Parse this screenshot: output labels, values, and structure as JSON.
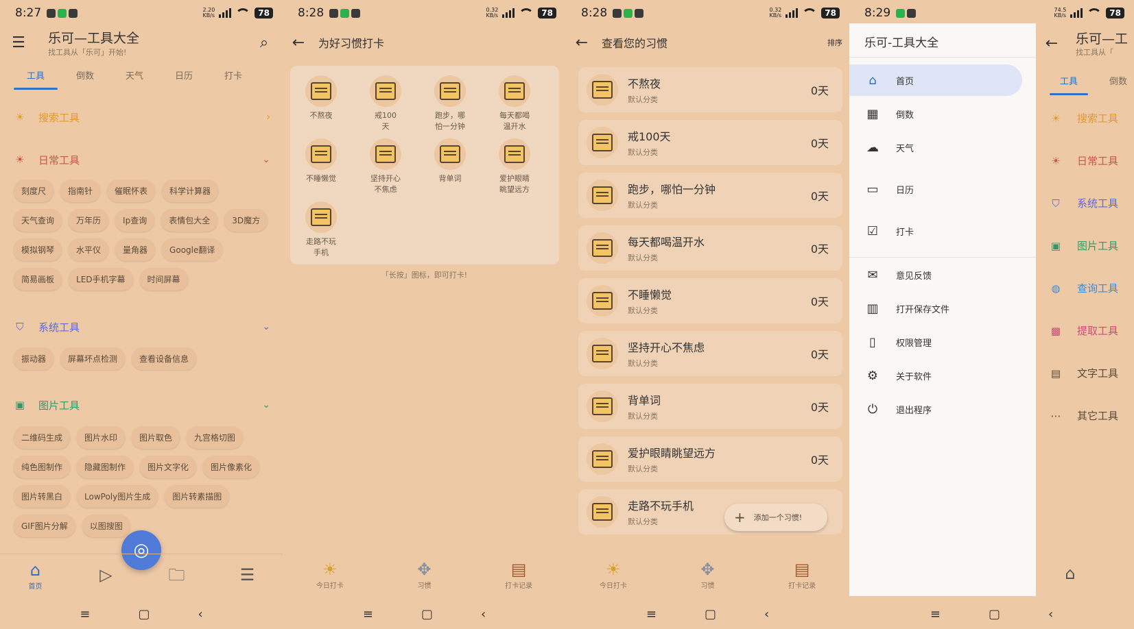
{
  "colors": {
    "bg": "#edc9a6",
    "accent": "#2a72c8",
    "red": "#c65a4a",
    "fab": "#4f7ad8",
    "search_tool": "#e39a30",
    "system": "#5a6ad8",
    "image": "#2e9a6a",
    "query": "#3d8ad8",
    "extract": "#d04a7a"
  },
  "status_bars": [
    {
      "time": "8:27",
      "net": "2.20\nKB/s",
      "battery": "78"
    },
    {
      "time": "8:28",
      "net": "0.32\nKB/s",
      "battery": "78"
    },
    {
      "time": "8:28",
      "net": "0.32\nKB/s",
      "battery": "78"
    },
    {
      "time": "8:29",
      "net": "74.5\nKB/s",
      "battery": "78"
    }
  ],
  "screen1": {
    "title": "乐可—工具大全",
    "subtitle": "找工具从「乐可」开始!",
    "tabs": [
      "工具",
      "倒数",
      "天气",
      "日历",
      "打卡"
    ],
    "search_tools": "搜索工具",
    "daily": {
      "title": "日常工具",
      "chips": [
        "刻度尺",
        "指南针",
        "催眠怀表",
        "科学计算器",
        "天气查询",
        "万年历",
        "Ip查询",
        "表情包大全",
        "3D魔方",
        "模拟钢琴",
        "水平仪",
        "量角器",
        "Google翻译",
        "简易画板",
        "LED手机字幕",
        "时间屏幕"
      ]
    },
    "system": {
      "title": "系统工具",
      "chips": [
        "振动器",
        "屏幕坏点检测",
        "查看设备信息"
      ]
    },
    "image": {
      "title": "图片工具",
      "chips": [
        "二维码生成",
        "图片水印",
        "图片取色",
        "九宫格切图",
        "纯色图制作",
        "隐藏图制作",
        "图片文字化",
        "图片像素化",
        "图片转黑白",
        "LowPoly图片生成",
        "图片转素描图",
        "GIF图片分解",
        "以图搜图"
      ]
    },
    "nav_home": "首页"
  },
  "screen2": {
    "title": "为好习惯打卡",
    "habits": [
      "不熬夜",
      "戒100\n天",
      "跑步，哪\n怕一分钟",
      "每天都喝\n温开水",
      "不睡懒觉",
      "坚持开心\n不焦虑",
      "背单词",
      "爱护眼睛\n眺望远方",
      "走路不玩\n手机"
    ],
    "hint": "「长按」图标，即可打卡!",
    "nav": [
      "今日打卡",
      "习惯",
      "打卡记录"
    ]
  },
  "screen3": {
    "title": "查看您的习惯",
    "sort": "排序",
    "category": "默认分类",
    "items": [
      {
        "name": "不熬夜",
        "days": "0天"
      },
      {
        "name": "戒100天",
        "days": "0天"
      },
      {
        "name": "跑步，哪怕一分钟",
        "days": "0天"
      },
      {
        "name": "每天都喝温开水",
        "days": "0天"
      },
      {
        "name": "不睡懒觉",
        "days": "0天"
      },
      {
        "name": "坚持开心不焦虑",
        "days": "0天"
      },
      {
        "name": "背单词",
        "days": "0天"
      },
      {
        "name": "爱护眼睛眺望远方",
        "days": "0天"
      },
      {
        "name": "走路不玩手机",
        "days": ""
      }
    ],
    "add": "添加一个习惯!",
    "nav": [
      "今日打卡",
      "习惯",
      "打卡记录"
    ]
  },
  "screen4": {
    "drawer_title": "乐可-工具大全",
    "drawer_items": [
      "首页",
      "倒数",
      "天气",
      "日历",
      "打卡",
      "意见反馈",
      "打开保存文件",
      "权限管理",
      "关于软件",
      "退出程序"
    ],
    "behind_title": "乐可—工",
    "behind_subtitle": "找工具从「",
    "behind_tabs": [
      "工具",
      "倒数"
    ],
    "behind_sections": [
      "搜索工具",
      "日常工具",
      "系统工具",
      "图片工具",
      "查询工具",
      "提取工具",
      "文字工具",
      "其它工具"
    ]
  }
}
